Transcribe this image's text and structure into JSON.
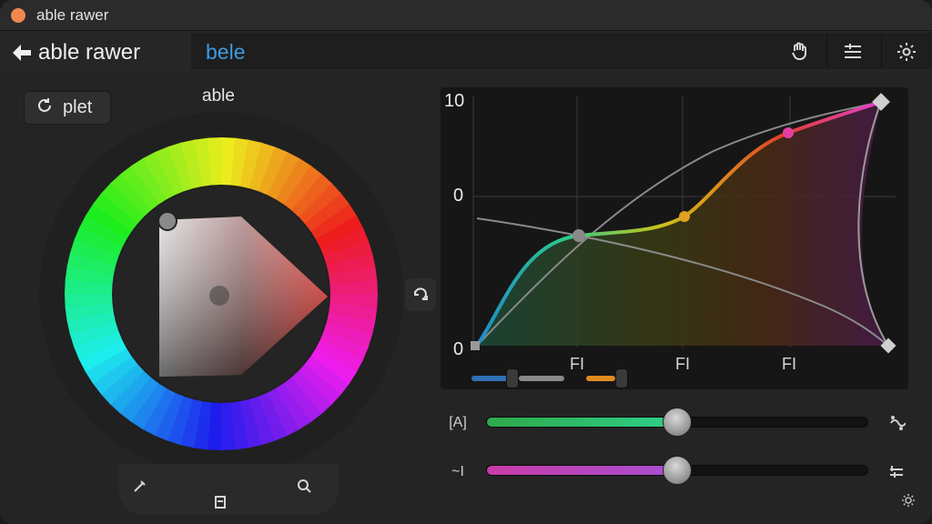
{
  "window": {
    "title": "able rawer"
  },
  "header": {
    "title": "able rawer",
    "tab_label": "bele"
  },
  "toolbar": {
    "icons": [
      "hand-icon",
      "list-icon",
      "gear-icon"
    ]
  },
  "panel": {
    "preset_button_label": "plet",
    "wheel_label": "able"
  },
  "colors": {
    "accent": "#3d9be0",
    "window_dot": "#f0874f",
    "green_fill": "#2bb673",
    "magenta_fill": "#c040c0"
  },
  "graph": {
    "y_top_label": "10",
    "y_mid_label": "0",
    "y_bottom_label": "0",
    "x_labels": [
      "FI",
      "FI",
      "FI"
    ]
  },
  "sliders": [
    {
      "name": "green",
      "icon_left": "[A]",
      "icon_right": "spark-icon",
      "value": 0.5
    },
    {
      "name": "magenta",
      "icon_left": "~I",
      "icon_right": "tune-icon",
      "value": 0.5
    }
  ]
}
